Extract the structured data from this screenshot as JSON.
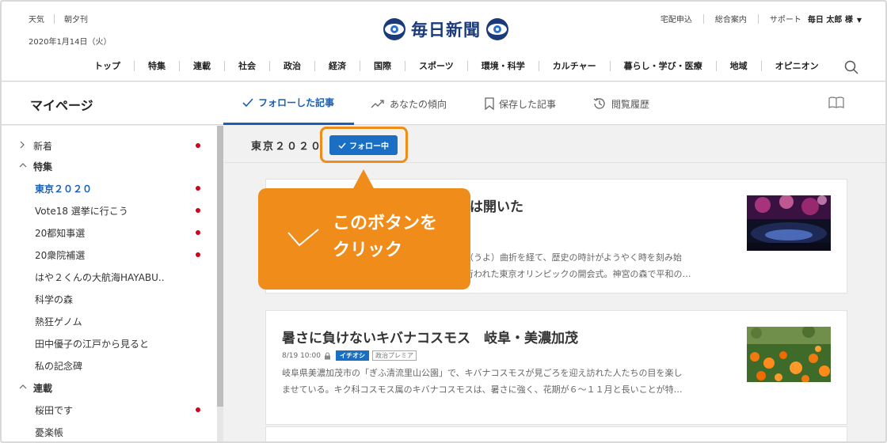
{
  "header": {
    "util_left": [
      "天気",
      "朝夕刊"
    ],
    "date": "2020年1月14日（火）",
    "logo_text": "毎日新聞",
    "util_right": [
      "宅配申込",
      "総合案内",
      "サポート"
    ],
    "user_name": "毎日 太郎 様",
    "user_caret": "▼",
    "nav": [
      "トップ",
      "特集",
      "連載",
      "社会",
      "政治",
      "経済",
      "国際",
      "スポーツ",
      "環境・科学",
      "カルチャー",
      "暮らし・学び・医療",
      "地域",
      "オピニオン"
    ]
  },
  "tabs": {
    "mypage": "マイページ",
    "items": [
      {
        "label": "フォローした記事",
        "icon": "check-icon",
        "active": true
      },
      {
        "label": "あなたの傾向",
        "icon": "trend-icon",
        "active": false
      },
      {
        "label": "保存した記事",
        "icon": "bookmark-icon",
        "active": false
      },
      {
        "label": "閲覧履歴",
        "icon": "history-icon",
        "active": false
      }
    ]
  },
  "sidebar": {
    "items": [
      {
        "label": "新着",
        "type": "group",
        "chevron": ">",
        "dot": true
      },
      {
        "label": "特集",
        "type": "group",
        "chevron": "^",
        "dot": false
      },
      {
        "label": "東京２０２０",
        "type": "sub",
        "active": true,
        "dot": true
      },
      {
        "label": "Vote18 選挙に行こう",
        "type": "sub",
        "dot": true
      },
      {
        "label": "20都知事選",
        "type": "sub",
        "dot": true
      },
      {
        "label": "20衆院補選",
        "type": "sub",
        "dot": true
      },
      {
        "label": "はや２くんの大航海HAYABU..",
        "type": "sub",
        "dot": false
      },
      {
        "label": "科学の森",
        "type": "sub",
        "dot": false
      },
      {
        "label": "熱狂ゲノム",
        "type": "sub",
        "dot": false
      },
      {
        "label": "田中優子の江戸から見ると",
        "type": "sub",
        "dot": false
      },
      {
        "label": "私の記念碑",
        "type": "sub",
        "dot": false
      },
      {
        "label": "連載",
        "type": "group",
        "chevron": "^",
        "dot": false
      },
      {
        "label": "桜田です",
        "type": "sub",
        "dot": true
      },
      {
        "label": "憂楽帳",
        "type": "sub",
        "dot": false
      }
    ]
  },
  "main": {
    "topic_title": "東京２０２０",
    "follow_button": "フォロー中",
    "articles": [
      {
        "title_visible": "幕は開いた",
        "excerpt_line1": "余（うよ）曲折を経て、歴史の時計がようやく時を刻み始",
        "excerpt_line2": "に行われた東京オリンピックの開会式。神宮の森で平和の…"
      },
      {
        "title": "暑さに負けないキバナコスモス　岐阜・美濃加茂",
        "date": "8/19 10:00",
        "badge_primary": "イチオシ",
        "badge_secondary": "政治プレミア",
        "excerpt_line1": "岐阜県美濃加茂市の「ぎふ清流里山公園」で、キバナコスモスが見ごろを迎え訪れた人たちの目を楽し",
        "excerpt_line2": "ませている。キク科コスモス属のキバナコスモスは、暑さに強く、花期が６～１１月と長いことが特…"
      }
    ]
  },
  "callout": {
    "line1": "このボタンを",
    "line2": "クリック"
  },
  "colors": {
    "accent_blue": "#1a6fc4",
    "callout_orange": "#ef8c1a",
    "dot_red": "#d0021b"
  }
}
